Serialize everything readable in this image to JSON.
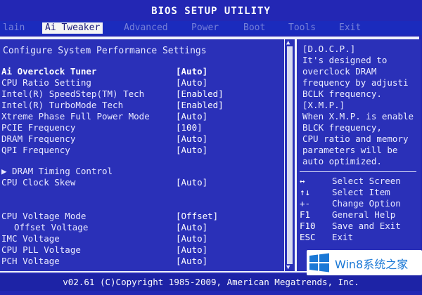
{
  "app": {
    "title": "BIOS SETUP UTILITY"
  },
  "menu": {
    "items": [
      {
        "label": "Main",
        "shown": "lain"
      },
      {
        "label": "Ai Tweaker",
        "shown": "Ai Tweaker"
      },
      {
        "label": "Advanced",
        "shown": "Advanced"
      },
      {
        "label": "Power",
        "shown": "Power"
      },
      {
        "label": "Boot",
        "shown": "Boot"
      },
      {
        "label": "Tools",
        "shown": "Tools"
      },
      {
        "label": "Exit",
        "shown": "Exit"
      }
    ],
    "active_index": 1
  },
  "main": {
    "section_title": "Configure System Performance Settings",
    "settings": [
      {
        "label": "Ai Overclock Tuner",
        "value": "[Auto]",
        "selected": true
      },
      {
        "label": "CPU Ratio Setting",
        "value": "[Auto]"
      },
      {
        "label": "Intel(R) SpeedStep(TM) Tech",
        "value": "[Enabled]"
      },
      {
        "label": "Intel(R) TurboMode Tech",
        "value": "[Enabled]"
      },
      {
        "label": "Xtreme Phase Full Power Mode",
        "value": "[Auto]"
      },
      {
        "label": "PCIE Frequency",
        "value": "[100]"
      },
      {
        "label": "DRAM Frequency",
        "value": "[Auto]"
      },
      {
        "label": "QPI Frequency",
        "value": "[Auto]"
      },
      {
        "label": "▶ DRAM Timing Control",
        "value": ""
      },
      {
        "label": "CPU Clock Skew",
        "value": "[Auto]"
      },
      {
        "label": "CPU Voltage Mode",
        "value": "[Offset]"
      },
      {
        "label": "Offset Voltage",
        "value": "[Auto]",
        "indent": true
      },
      {
        "label": "IMC Voltage",
        "value": "[Auto]"
      },
      {
        "label": "CPU PLL Voltage",
        "value": "[Auto]"
      },
      {
        "label": "PCH Voltage",
        "value": "[Auto]"
      }
    ]
  },
  "help": {
    "lines": [
      "[D.O.C.P.]",
      "It's designed to",
      "overclock DRAM",
      "frequency by adjusti",
      "BCLK frequency.",
      "[X.M.P.]",
      "When X.M.P. is enable",
      "BLCK frequency,",
      "CPU ratio and memory",
      "parameters will be",
      "auto optimized."
    ],
    "keys": [
      {
        "key": "↔",
        "desc": "Select Screen"
      },
      {
        "key": "↑↓",
        "desc": "Select Item"
      },
      {
        "key": "+-",
        "desc": "Change Option"
      },
      {
        "key": "F1",
        "desc": "General Help"
      },
      {
        "key": "F10",
        "desc": "Save and Exit"
      },
      {
        "key": "ESC",
        "desc": "Exit"
      }
    ]
  },
  "footer": {
    "text": "v02.61 (C)Copyright 1985-2009, American Megatrends, Inc."
  },
  "watermark": {
    "text": "Win8系统之家",
    "icon": "windows-logo-icon"
  },
  "colors": {
    "background": "#2327b4",
    "frame": "#f1f3fb",
    "active_tab": "#f4f4f4",
    "watermark_text": "#1a78d6"
  }
}
